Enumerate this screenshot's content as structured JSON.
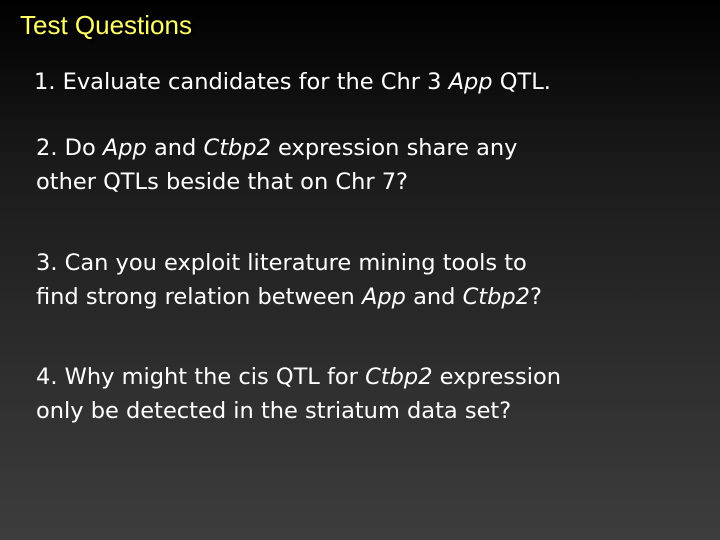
{
  "title": "Test Questions",
  "questions": [
    {
      "line1": {
        "a": "1. Evaluate candidates for the Chr 3 ",
        "b": "App",
        "c": " QTL."
      }
    },
    {
      "line1": {
        "a": "2. Do ",
        "b": "App",
        "c": " and ",
        "d": "Ctbp2",
        "e": " expression share any"
      },
      "line2": "other QTLs beside that on Chr 7?"
    },
    {
      "line1": "3. Can you exploit literature mining tools to",
      "line2": {
        "a": "find strong relation between ",
        "b": "App",
        "c": " and ",
        "d": "Ctbp2",
        "e": "?"
      }
    },
    {
      "line1": {
        "a": "4. Why might the cis QTL for ",
        "b": "Ctbp2",
        "c": " expression"
      },
      "line2": "only be detected in the striatum data set?"
    }
  ],
  "colors": {
    "title": "#ffff66",
    "text": "#ffffff",
    "background_top": "#000000",
    "background_bottom": "#3d3d3d"
  }
}
